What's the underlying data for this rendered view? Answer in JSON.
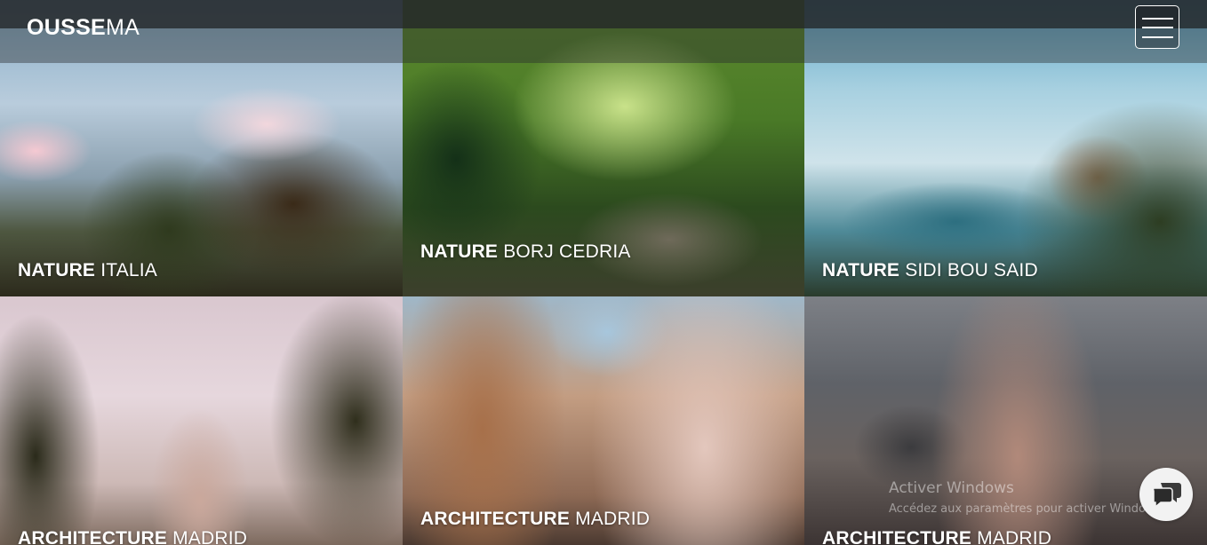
{
  "brand": {
    "bold": "OUSSE",
    "light": "MA"
  },
  "gallery": [
    {
      "category": "NATURE",
      "place": "ITALIA"
    },
    {
      "category": "NATURE",
      "place": "BORJ CEDRIA"
    },
    {
      "category": "NATURE",
      "place": "SIDI BOU SAID"
    },
    {
      "category": "ARCHITECTURE",
      "place": "MADRID"
    },
    {
      "category": "ARCHITECTURE",
      "place": "MADRID"
    },
    {
      "category": "ARCHITECTURE",
      "place": "MADRID"
    }
  ],
  "watermark": {
    "title": "Activer Windows",
    "subtitle": "Accédez aux paramètres pour activer Windows."
  },
  "icons": {
    "menu": "hamburger-menu-icon",
    "chat": "chat-bubbles-icon"
  }
}
